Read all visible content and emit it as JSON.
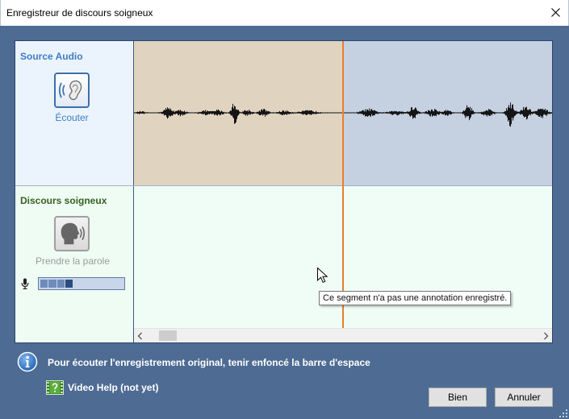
{
  "window": {
    "title": "Enregistreur de discours soigneux"
  },
  "source_audio": {
    "heading": "Source Audio",
    "listen_label": "Écouter"
  },
  "careful_speech": {
    "heading": "Discours soigneux",
    "speak_label": "Prendre la parole",
    "input_level": 0.4
  },
  "tooltip": {
    "text": "Ce segment n'a pas une annotation enregistré."
  },
  "hint": {
    "text": "Pour écouter l'enregistrement original, tenir enfoncé la barre d'espace"
  },
  "video_help": {
    "label": "Video Help (not yet)"
  },
  "buttons": {
    "ok": "Bien",
    "cancel": "Annuler"
  },
  "icons": {
    "close": "close-icon",
    "listen": "ear-icon",
    "speak": "speaking-head-icon",
    "microphone": "microphone-icon",
    "info": "info-icon",
    "video_help": "video-help-icon",
    "scroll_left": "chevron-left-icon",
    "scroll_right": "chevron-right-icon"
  },
  "colors": {
    "window_background": "#4e6b93",
    "source_heading": "#3f7cc4",
    "speech_heading": "#35611f",
    "playhead": "#e6802a",
    "current_segment": "#e0d4c1",
    "remaining_audio": "#c5d0e1"
  }
}
